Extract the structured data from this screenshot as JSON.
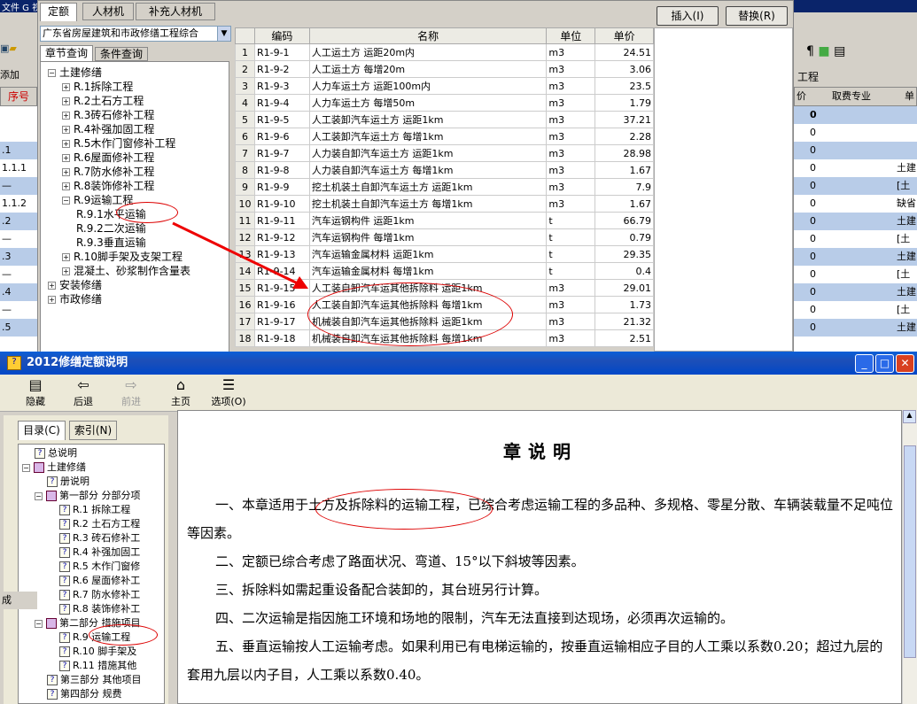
{
  "bg": {
    "menubar": "文件  G   视",
    "seq_header": "序号",
    "left_rows": [
      ".1",
      "1.1.1",
      "—",
      "1.1.2",
      ".2",
      "—",
      ".3",
      "—",
      ".4",
      "—",
      ".5"
    ],
    "right_header": [
      "价",
      "取费专业",
      "单"
    ],
    "right_rows": [
      [
        "0",
        "",
        ""
      ],
      [
        "0",
        "",
        ""
      ],
      [
        "0",
        "",
        ""
      ],
      [
        "0",
        "",
        "土建"
      ],
      [
        "0",
        "",
        "[土"
      ],
      [
        "0",
        "",
        "缺省"
      ],
      [
        "0",
        "",
        "土建"
      ],
      [
        "0",
        "",
        "[土"
      ],
      [
        "0",
        "",
        "土建"
      ],
      [
        "0",
        "",
        "[土"
      ],
      [
        "0",
        "",
        "土建"
      ],
      [
        "0",
        "",
        "[土"
      ],
      [
        "0",
        "",
        "土建"
      ]
    ],
    "right_label": "工程",
    "left_labels": [
      "添加",
      "成"
    ]
  },
  "quota": {
    "tabs": [
      "定额",
      "人材机",
      "补充人材机"
    ],
    "insert_btn": "插入(I)",
    "replace_btn": "替换(R)",
    "combo_value": "广东省房屋建筑和市政修缮工程综合",
    "subtabs": [
      "章节查询",
      "条件查询"
    ],
    "tree": [
      {
        "t": "土建修缮",
        "lvl": 0,
        "pm": "−"
      },
      {
        "t": "R.1拆除工程",
        "lvl": 1,
        "pm": "+"
      },
      {
        "t": "R.2土石方工程",
        "lvl": 1,
        "pm": "+"
      },
      {
        "t": "R.3砖石修补工程",
        "lvl": 1,
        "pm": "+"
      },
      {
        "t": "R.4补强加固工程",
        "lvl": 1,
        "pm": "+"
      },
      {
        "t": "R.5木作门窗修补工程",
        "lvl": 1,
        "pm": "+"
      },
      {
        "t": "R.6屋面修补工程",
        "lvl": 1,
        "pm": "+"
      },
      {
        "t": "R.7防水修补工程",
        "lvl": 1,
        "pm": "+"
      },
      {
        "t": "R.8装饰修补工程",
        "lvl": 1,
        "pm": "+"
      },
      {
        "t": "R.9运输工程",
        "lvl": 1,
        "pm": "−"
      },
      {
        "t": "R.9.1水平运输",
        "lvl": 2,
        "pm": ""
      },
      {
        "t": "R.9.2二次运输",
        "lvl": 2,
        "pm": ""
      },
      {
        "t": "R.9.3垂直运输",
        "lvl": 2,
        "pm": ""
      },
      {
        "t": "R.10脚手架及支架工程",
        "lvl": 1,
        "pm": "+"
      },
      {
        "t": "混凝土、砂浆制作含量表",
        "lvl": 1,
        "pm": "+"
      },
      {
        "t": "安装修缮",
        "lvl": 0,
        "pm": "+"
      },
      {
        "t": "市政修缮",
        "lvl": 0,
        "pm": "+"
      }
    ],
    "columns": [
      "",
      "编码",
      "名称",
      "单位",
      "单价"
    ],
    "rows": [
      [
        "1",
        "R1-9-1",
        "人工运土方 运距20m内",
        "m3",
        "24.51"
      ],
      [
        "2",
        "R1-9-2",
        "人工运土方 每增20m",
        "m3",
        "3.06"
      ],
      [
        "3",
        "R1-9-3",
        "人力车运土方 运距100m内",
        "m3",
        "23.5"
      ],
      [
        "4",
        "R1-9-4",
        "人力车运土方 每增50m",
        "m3",
        "1.79"
      ],
      [
        "5",
        "R1-9-5",
        "人工装卸汽车运土方 运距1km",
        "m3",
        "37.21"
      ],
      [
        "6",
        "R1-9-6",
        "人工装卸汽车运土方 每增1km",
        "m3",
        "2.28"
      ],
      [
        "7",
        "R1-9-7",
        "人力装自卸汽车运土方 运距1km",
        "m3",
        "28.98"
      ],
      [
        "8",
        "R1-9-8",
        "人力装自卸汽车运土方 每增1km",
        "m3",
        "1.67"
      ],
      [
        "9",
        "R1-9-9",
        "挖土机装土自卸汽车运土方 运距1km",
        "m3",
        "7.9"
      ],
      [
        "10",
        "R1-9-10",
        "挖土机装土自卸汽车运土方 每增1km",
        "m3",
        "1.67"
      ],
      [
        "11",
        "R1-9-11",
        "汽车运钢构件 运距1km",
        "t",
        "66.79"
      ],
      [
        "12",
        "R1-9-12",
        "汽车运钢构件 每增1km",
        "t",
        "0.79"
      ],
      [
        "13",
        "R1-9-13",
        "汽车运输金属材料 运距1km",
        "t",
        "29.35"
      ],
      [
        "14",
        "R1-9-14",
        "汽车运输金属材料 每增1km",
        "t",
        "0.4"
      ],
      [
        "15",
        "R1-9-15",
        "人工装自卸汽车运其他拆除料 运距1km",
        "m3",
        "29.01"
      ],
      [
        "16",
        "R1-9-16",
        "人工装自卸汽车运其他拆除料 每增1km",
        "m3",
        "1.73"
      ],
      [
        "17",
        "R1-9-17",
        "机械装自卸汽车运其他拆除料 运距1km",
        "m3",
        "21.32"
      ],
      [
        "18",
        "R1-9-18",
        "机械装自卸汽车运其他拆除料 每增1km",
        "m3",
        "2.51"
      ]
    ]
  },
  "help": {
    "title": "2012修缮定额说明",
    "toolbar": [
      {
        "label": "隐藏",
        "icon": "hide-icon",
        "glyph": "▤"
      },
      {
        "label": "后退",
        "icon": "back-icon",
        "glyph": "⇦"
      },
      {
        "label": "前进",
        "icon": "forward-icon",
        "glyph": "⇨"
      },
      {
        "label": "主页",
        "icon": "home-icon",
        "glyph": "⌂"
      },
      {
        "label": "选项(O)",
        "icon": "options-icon",
        "glyph": "☰"
      }
    ],
    "nav_tabs": [
      "目录(C)",
      "索引(N)"
    ],
    "nav_tree": [
      {
        "t": "总说明",
        "lvl": 1,
        "k": "q"
      },
      {
        "t": "土建修缮",
        "lvl": 0,
        "k": "b"
      },
      {
        "t": "册说明",
        "lvl": 2,
        "k": "q"
      },
      {
        "t": "第一部分 分部分项",
        "lvl": 1,
        "k": "b"
      },
      {
        "t": "R.1 拆除工程",
        "lvl": 3,
        "k": "q"
      },
      {
        "t": "R.2 土石方工程",
        "lvl": 3,
        "k": "q"
      },
      {
        "t": "R.3 砖石修补工",
        "lvl": 3,
        "k": "q"
      },
      {
        "t": "R.4 补强加固工",
        "lvl": 3,
        "k": "q"
      },
      {
        "t": "R.5 木作门窗修",
        "lvl": 3,
        "k": "q"
      },
      {
        "t": "R.6 屋面修补工",
        "lvl": 3,
        "k": "q"
      },
      {
        "t": "R.7 防水修补工",
        "lvl": 3,
        "k": "q"
      },
      {
        "t": "R.8 装饰修补工",
        "lvl": 3,
        "k": "q"
      },
      {
        "t": "第二部分 措施项目",
        "lvl": 1,
        "k": "b"
      },
      {
        "t": "R.9 运输工程",
        "lvl": 3,
        "k": "q"
      },
      {
        "t": "R.10 脚手架及",
        "lvl": 3,
        "k": "q"
      },
      {
        "t": "R.11 措施其他",
        "lvl": 3,
        "k": "q"
      },
      {
        "t": "第三部分 其他项目",
        "lvl": 2,
        "k": "q"
      },
      {
        "t": "第四部分 规费",
        "lvl": 2,
        "k": "q"
      }
    ],
    "content_title": "章说明",
    "paragraphs": [
      "一、本章适用于土方及拆除料的运输工程，已综合考虑运输工程的多品种、多规格、零星分散、车辆装载量不足吨位等因素。",
      "二、定额已综合考虑了路面状况、弯道、15°以下斜坡等因素。",
      "三、拆除料如需起重设备配合装卸的，其台班另行计算。",
      "四、二次运输是指因施工环境和场地的限制，汽车无法直接到达现场，必须再次运输的。",
      "五、垂直运输按人工运输考虑。如果利用已有电梯运输的，按垂直运输相应子目的人工乘以系数0.20；超过九层的套用九层以内子目，人工乘以系数0.40。"
    ]
  }
}
